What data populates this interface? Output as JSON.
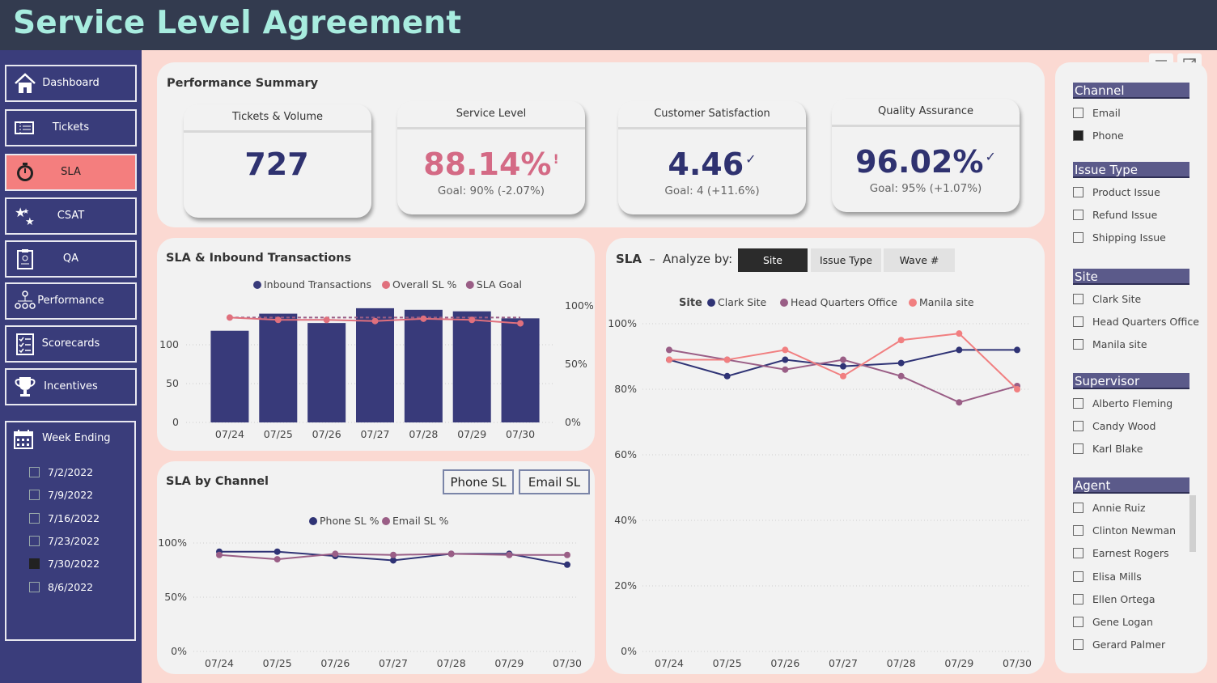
{
  "header": {
    "title": "Service Level Agreement"
  },
  "nav": [
    {
      "label": "Dashboard",
      "icon": "home-icon"
    },
    {
      "label": "Tickets",
      "icon": "ticket-icon"
    },
    {
      "label": "SLA",
      "icon": "stopwatch-icon",
      "active": true
    },
    {
      "label": "CSAT",
      "icon": "stars-icon"
    },
    {
      "label": "QA",
      "icon": "clipboard-icon"
    },
    {
      "label": "Performance",
      "icon": "org-chart-icon"
    },
    {
      "label": "Scorecards",
      "icon": "checklist-icon"
    },
    {
      "label": "Incentives",
      "icon": "trophy-icon"
    }
  ],
  "week_ending": {
    "title": "Week Ending",
    "items": [
      {
        "label": "7/2/2022",
        "checked": false
      },
      {
        "label": "7/9/2022",
        "checked": false
      },
      {
        "label": "7/16/2022",
        "checked": false
      },
      {
        "label": "7/23/2022",
        "checked": false
      },
      {
        "label": "7/30/2022",
        "checked": true
      },
      {
        "label": "8/6/2022",
        "checked": false
      }
    ]
  },
  "summary": {
    "title": "Performance Summary",
    "kpis": [
      {
        "title": "Tickets & Volume",
        "value": "727",
        "goal": "",
        "mark": "",
        "color": "#2f3270"
      },
      {
        "title": "Service Level",
        "value": "88.14%",
        "goal": "Goal: 90% (-2.07%)",
        "mark": "!",
        "color": "#d46a85"
      },
      {
        "title": "Customer Satisfaction",
        "value": "4.46",
        "goal": "Goal: 4 (+11.6%)",
        "mark": "✓",
        "color": "#2f3270"
      },
      {
        "title": "Quality Assurance",
        "value": "96.02%",
        "goal": "Goal: 95% (+1.07%)",
        "mark": "✓",
        "color": "#2f3270"
      }
    ]
  },
  "colors": {
    "navy": "#383a7a",
    "pink": "#e0707d",
    "mauve": "#9a5e86",
    "salmon": "#f17f80",
    "clark": "#2f3375"
  },
  "chart_data": [
    {
      "type": "bar",
      "title": "SLA & Inbound Transactions",
      "categories": [
        "07/24",
        "07/25",
        "07/26",
        "07/27",
        "07/28",
        "07/29",
        "07/30"
      ],
      "series": [
        {
          "name": "Inbound Transactions",
          "values": [
            118,
            140,
            128,
            147,
            145,
            143,
            134
          ]
        },
        {
          "name": "Overall SL %",
          "values": [
            90,
            88,
            88,
            87,
            89,
            88,
            85
          ]
        },
        {
          "name": "SLA Goal",
          "values": [
            90,
            90,
            90,
            90,
            90,
            90,
            90
          ]
        }
      ],
      "y_ticks": [
        "0",
        "50",
        "100"
      ],
      "y2_ticks": [
        "0%",
        "50%",
        "100%"
      ],
      "ylim": [
        0,
        150
      ],
      "y2lim": [
        0,
        100
      ]
    },
    {
      "type": "line",
      "title": "SLA by Channel",
      "categories": [
        "07/24",
        "07/25",
        "07/26",
        "07/27",
        "07/28",
        "07/29",
        "07/30"
      ],
      "series": [
        {
          "name": "Phone SL %",
          "values": [
            92,
            92,
            88,
            84,
            90,
            90,
            80
          ]
        },
        {
          "name": "Email SL %",
          "values": [
            89,
            85,
            90,
            89,
            90,
            89,
            89
          ]
        }
      ],
      "y_ticks": [
        "0%",
        "50%",
        "100%"
      ],
      "ylim": [
        0,
        100
      ]
    },
    {
      "type": "line",
      "title": "SLA",
      "legend_title": "Site",
      "categories": [
        "07/24",
        "07/25",
        "07/26",
        "07/27",
        "07/28",
        "07/29",
        "07/30"
      ],
      "series": [
        {
          "name": "Clark Site",
          "values": [
            89,
            84,
            89,
            87,
            88,
            92,
            92
          ]
        },
        {
          "name": "Head Quarters Office",
          "values": [
            92,
            89,
            86,
            89,
            84,
            76,
            81
          ]
        },
        {
          "name": "Manila site",
          "values": [
            89,
            89,
            92,
            84,
            95,
            97,
            80
          ]
        }
      ],
      "y_ticks": [
        "0%",
        "20%",
        "40%",
        "60%",
        "80%",
        "100%"
      ],
      "ylim": [
        0,
        100
      ]
    }
  ],
  "sla_analyze": {
    "dash": "–",
    "label": "Analyze by:",
    "tabs": [
      "Site",
      "Issue Type",
      "Wave #"
    ]
  },
  "channel_buttons": [
    "Phone SL",
    "Email SL"
  ],
  "slicers": [
    {
      "title": "Channel",
      "items": [
        {
          "label": "Email",
          "checked": false
        },
        {
          "label": "Phone",
          "checked": true
        }
      ]
    },
    {
      "title": "Issue Type",
      "items": [
        {
          "label": "Product Issue",
          "checked": false
        },
        {
          "label": "Refund Issue",
          "checked": false
        },
        {
          "label": "Shipping Issue",
          "checked": false
        }
      ]
    },
    {
      "title": "Site",
      "items": [
        {
          "label": "Clark Site",
          "checked": false
        },
        {
          "label": "Head Quarters Office",
          "checked": false
        },
        {
          "label": "Manila site",
          "checked": false
        }
      ]
    },
    {
      "title": "Supervisor",
      "items": [
        {
          "label": "Alberto Fleming",
          "checked": false
        },
        {
          "label": "Candy Wood",
          "checked": false
        },
        {
          "label": "Karl Blake",
          "checked": false
        }
      ]
    },
    {
      "title": "Agent",
      "items": [
        {
          "label": "Annie Ruiz",
          "checked": false
        },
        {
          "label": "Clinton Newman",
          "checked": false
        },
        {
          "label": "Earnest Rogers",
          "checked": false
        },
        {
          "label": "Elisa Mills",
          "checked": false
        },
        {
          "label": "Ellen Ortega",
          "checked": false
        },
        {
          "label": "Gene Logan",
          "checked": false
        },
        {
          "label": "Gerard Palmer",
          "checked": false
        }
      ]
    }
  ]
}
